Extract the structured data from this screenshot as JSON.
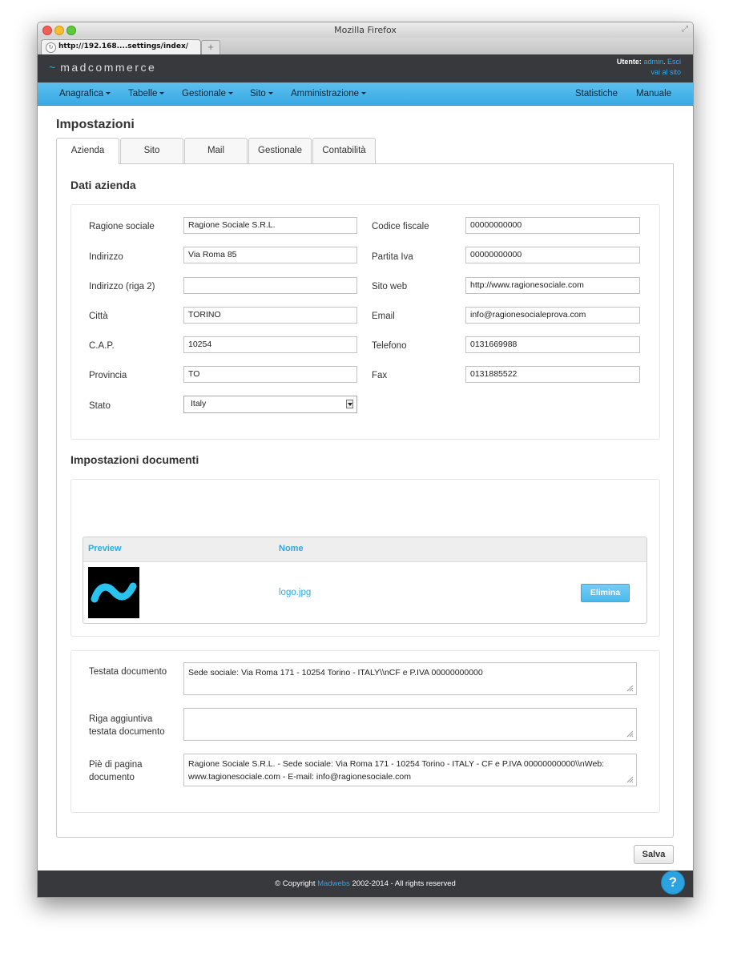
{
  "browser": {
    "window_title": "Mozilla Firefox",
    "tab_url": "http://192.168....settings/index/",
    "new_tab_symbol": "+"
  },
  "header": {
    "brand": "madcommerce",
    "brand_symbol": "~",
    "user_label": "Utente:",
    "user_name": "admin",
    "separator": ".",
    "logout": "Esci",
    "site_link": "vai al sito"
  },
  "nav": {
    "items": [
      "Anagrafica",
      "Tabelle",
      "Gestionale",
      "Sito",
      "Amministrazione"
    ],
    "right_items": [
      "Statistiche",
      "Manuale"
    ]
  },
  "page": {
    "title": "Impostazioni",
    "tabs": [
      "Azienda",
      "Sito",
      "Mail",
      "Gestionale",
      "Contabilità"
    ],
    "active_tab": "Azienda"
  },
  "company": {
    "section_title": "Dati azienda",
    "left_fields": [
      {
        "label": "Ragione sociale",
        "value": "Ragione Sociale  S.R.L."
      },
      {
        "label": "Indirizzo",
        "value": "Via Roma 85"
      },
      {
        "label": "Indirizzo (riga 2)",
        "value": ""
      },
      {
        "label": "Città",
        "value": "TORINO"
      },
      {
        "label": "C.A.P.",
        "value": "10254"
      },
      {
        "label": "Provincia",
        "value": "TO"
      },
      {
        "label": "Stato",
        "value": "Italy"
      }
    ],
    "right_fields": [
      {
        "label": "Codice fiscale",
        "value": "00000000000"
      },
      {
        "label": "Partita Iva",
        "value": "00000000000"
      },
      {
        "label": "Sito web",
        "value": "http://www.ragionesociale.com"
      },
      {
        "label": "Email",
        "value": "info@ragionesocialeprova.com"
      },
      {
        "label": "Telefono",
        "value": "0131669988"
      },
      {
        "label": "Fax",
        "value": "0131885522"
      }
    ]
  },
  "documents": {
    "section_title": "Impostazioni documenti",
    "table": {
      "headers": [
        "Preview",
        "Nome"
      ],
      "rows": [
        {
          "name": "logo.jpg",
          "action": "Elimina"
        }
      ]
    },
    "fields": [
      {
        "label": "Testata documento",
        "value": "Sede sociale: Via Roma 171 - 10254 Torino - ITALY\\\\nCF e P.IVA 00000000000"
      },
      {
        "label": "Riga aggiuntiva testata documento",
        "value": ""
      },
      {
        "label": "Piè di pagina documento",
        "value": "Ragione Sociale S.R.L. - Sede sociale: Via Roma 171 - 10254 Torino - ITALY - CF e P.IVA 00000000000\\\\nWeb: www.tagionesociale.com - E-mail: info@ragionesociale.com"
      }
    ]
  },
  "actions": {
    "save": "Salva"
  },
  "footer": {
    "prefix": "© Copyright",
    "brand": "Madwebs",
    "suffix": "2002-2014 - All rights reserved",
    "help": "?"
  },
  "colors": {
    "accent": "#29abe2",
    "nav_bg": "#45b3e8",
    "header_bg": "#37393c"
  }
}
